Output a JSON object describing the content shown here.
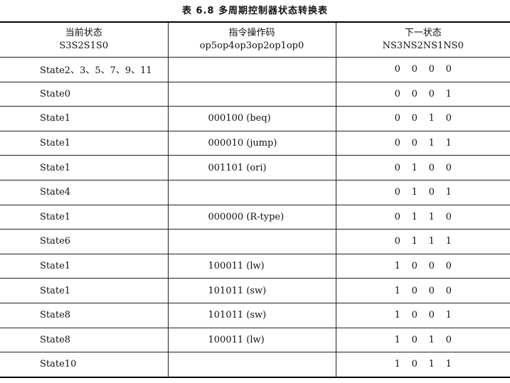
{
  "caption": "表 6.8   多周期控制器状态转换表",
  "headers": [
    {
      "line1": "当前状态",
      "line2": "S3S2S1S0"
    },
    {
      "line1": "指令操作码",
      "line2": "op5op4op3op2op1op0"
    },
    {
      "line1": "下一状态",
      "line2": "NS3NS2NS1NS0"
    }
  ],
  "rows": [
    {
      "state": "State2、3、5、7、9、11",
      "opcode": "",
      "next": [
        "0",
        "0",
        "0",
        "0"
      ]
    },
    {
      "state": "State0",
      "opcode": "",
      "next": [
        "0",
        "0",
        "0",
        "1"
      ]
    },
    {
      "state": "State1",
      "opcode": "000100 (beq)",
      "next": [
        "0",
        "0",
        "1",
        "0"
      ]
    },
    {
      "state": "State1",
      "opcode": "000010 (jump)",
      "next": [
        "0",
        "0",
        "1",
        "1"
      ]
    },
    {
      "state": "State1",
      "opcode": "001101 (ori)",
      "next": [
        "0",
        "1",
        "0",
        "0"
      ]
    },
    {
      "state": "State4",
      "opcode": "",
      "next": [
        "0",
        "1",
        "0",
        "1"
      ]
    },
    {
      "state": "State1",
      "opcode": "000000 (R-type)",
      "next": [
        "0",
        "1",
        "1",
        "0"
      ]
    },
    {
      "state": "State6",
      "opcode": "",
      "next": [
        "0",
        "1",
        "1",
        "1"
      ]
    },
    {
      "state": "State1",
      "opcode": "100011 (lw)",
      "next": [
        "1",
        "0",
        "0",
        "0"
      ]
    },
    {
      "state": "State1",
      "opcode": "101011 (sw)",
      "next": [
        "1",
        "0",
        "0",
        "0"
      ]
    },
    {
      "state": "State8",
      "opcode": "101011 (sw)",
      "next": [
        "1",
        "0",
        "0",
        "1"
      ]
    },
    {
      "state": "State8",
      "opcode": "100011 (lw)",
      "next": [
        "1",
        "0",
        "1",
        "0"
      ]
    },
    {
      "state": "State10",
      "opcode": "",
      "next": [
        "1",
        "0",
        "1",
        "1"
      ]
    }
  ]
}
